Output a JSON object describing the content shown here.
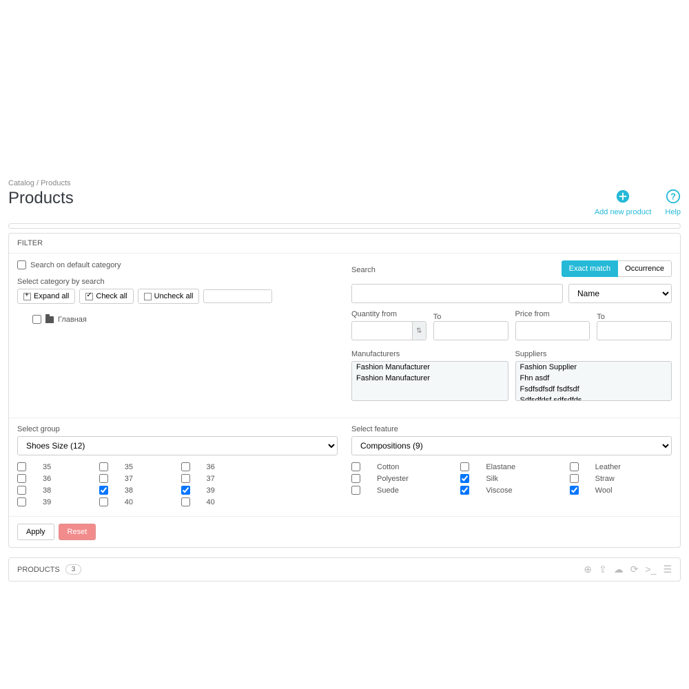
{
  "breadcrumb": {
    "a": "Catalog",
    "b": "Products"
  },
  "page_title": "Products",
  "header": {
    "add": "Add new product",
    "help": "Help"
  },
  "filter": {
    "heading": "FILTER",
    "search_default": "Search on default category",
    "select_category": "Select category by search",
    "expand_all": "Expand all",
    "check_all": "Check all",
    "uncheck_all": "Uncheck all",
    "tree_root": "Главная",
    "search_label": "Search",
    "exact_match": "Exact match",
    "occurrence": "Occurrence",
    "name_select": "Name",
    "qty_from": "Quantity from",
    "qty_to": "To",
    "price_from": "Price from",
    "price_to": "To",
    "manufacturers_label": "Manufacturers",
    "manufacturers": [
      "Fashion Manufacturer",
      "Fashion Manufacturer"
    ],
    "suppliers_label": "Suppliers",
    "suppliers": [
      "Fashion Supplier",
      "Fhn asdf",
      "Fsdfsdfsdf fsdfsdf",
      "Sdfsdfdsf sdfsdfds"
    ],
    "select_group": "Select group",
    "group_selected": "Shoes Size (12)",
    "sizes": [
      "35",
      "36",
      "38",
      "39",
      "35",
      "37",
      "38",
      "40",
      "36",
      "37",
      "39",
      "40"
    ],
    "sizes_checked": [
      false,
      false,
      false,
      false,
      false,
      false,
      true,
      false,
      false,
      false,
      true,
      false
    ],
    "select_feature": "Select feature",
    "feature_selected": "Compositions (9)",
    "features": [
      "Cotton",
      "Polyester",
      "Suede",
      "Elastane",
      "Silk",
      "Viscose",
      "Leather",
      "Straw",
      "Wool"
    ],
    "features_checked": [
      false,
      false,
      false,
      false,
      true,
      true,
      false,
      false,
      true
    ],
    "apply": "Apply",
    "reset": "Reset"
  },
  "products": {
    "label": "PRODUCTS",
    "count": "3"
  }
}
